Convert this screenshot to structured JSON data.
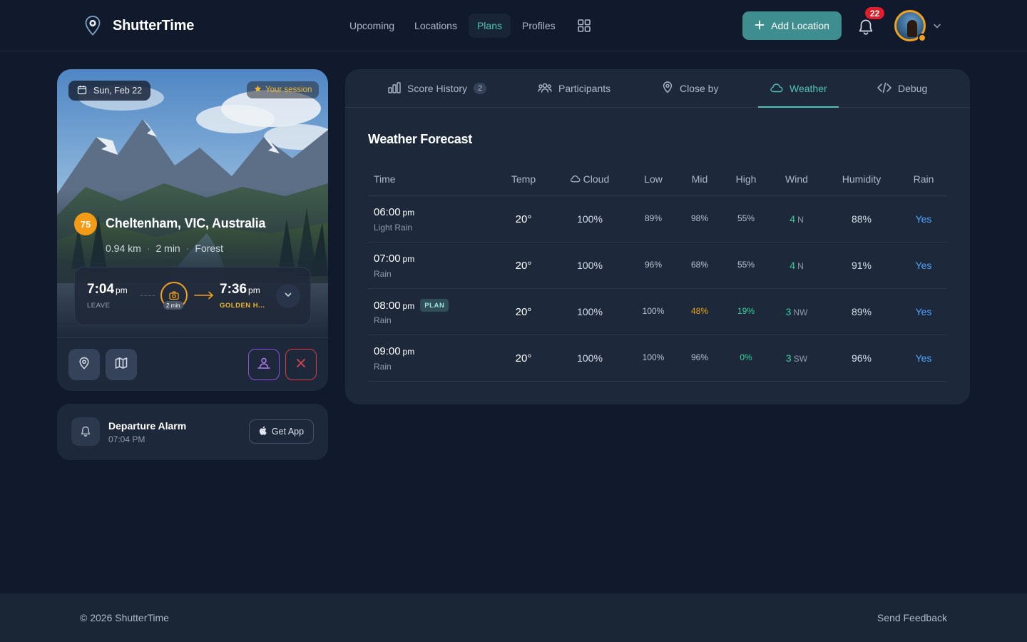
{
  "app": {
    "name": "ShutterTime"
  },
  "nav": {
    "items": [
      {
        "label": "Upcoming"
      },
      {
        "label": "Locations"
      },
      {
        "label": "Plans"
      },
      {
        "label": "Profiles"
      }
    ],
    "active": "Plans"
  },
  "header": {
    "add_location": "Add Location",
    "notifications": "22"
  },
  "location_card": {
    "date": "Sun, Feb 22",
    "session_label": "Your session",
    "score": "75",
    "title": "Cheltenham, VIC, Australia",
    "distance": "0.94 km",
    "duration": "2 min",
    "type": "Forest",
    "leave_time": "7:04",
    "leave_ampm": "pm",
    "leave_label": "LEAVE",
    "travel_label": "2 min",
    "golden_time": "7:36",
    "golden_ampm": "pm",
    "golden_label": "GOLDEN H..."
  },
  "alarm": {
    "title": "Departure Alarm",
    "time": "07:04 PM",
    "get_app": "Get App"
  },
  "tabs": [
    {
      "label": "Score History",
      "badge": "2"
    },
    {
      "label": "Participants"
    },
    {
      "label": "Close by"
    },
    {
      "label": "Weather"
    },
    {
      "label": "Debug"
    }
  ],
  "active_tab": "Weather",
  "weather": {
    "title": "Weather Forecast",
    "columns": [
      "Time",
      "Temp",
      "Cloud",
      "Low",
      "Mid",
      "High",
      "Wind",
      "Humidity",
      "Rain"
    ],
    "rows": [
      {
        "time": "06:00",
        "ampm": "pm",
        "desc": "Light Rain",
        "plan": "",
        "temp": "20°",
        "cloud": "100%",
        "low": "89%",
        "mid": "98%",
        "high": "55%",
        "wind_speed": "4",
        "wind_dir": "N",
        "humidity": "88%",
        "rain": "Yes"
      },
      {
        "time": "07:00",
        "ampm": "pm",
        "desc": "Rain",
        "plan": "",
        "temp": "20°",
        "cloud": "100%",
        "low": "96%",
        "mid": "68%",
        "high": "55%",
        "wind_speed": "4",
        "wind_dir": "N",
        "humidity": "91%",
        "rain": "Yes"
      },
      {
        "time": "08:00",
        "ampm": "pm",
        "desc": "Rain",
        "plan": "PLAN",
        "temp": "20°",
        "cloud": "100%",
        "low": "100%",
        "mid": "48%",
        "high": "19%",
        "wind_speed": "3",
        "wind_dir": "NW",
        "humidity": "89%",
        "rain": "Yes"
      },
      {
        "time": "09:00",
        "ampm": "pm",
        "desc": "Rain",
        "plan": "",
        "temp": "20°",
        "cloud": "100%",
        "low": "100%",
        "mid": "96%",
        "high": "0%",
        "wind_speed": "3",
        "wind_dir": "SW",
        "humidity": "96%",
        "rain": "Yes"
      }
    ]
  },
  "footer": {
    "copyright": "© 2026 ShutterTime",
    "feedback": "Send Feedback"
  },
  "colors": {
    "background": "#111a2c",
    "card": "#1d293b",
    "accent_teal": "#4ec3b8",
    "button_teal": "#3e8e8f",
    "gold": "#f2a21d",
    "wind_green": "#34d399",
    "rain_blue": "#4ea3ff",
    "mid_amber": "#e8a417",
    "badge_red": "#e01e2b"
  },
  "icons": [
    "location-pin-icon",
    "grid-icon",
    "plus-icon",
    "bell-icon",
    "chevron-down-icon",
    "calendar-icon",
    "star-icon",
    "camera-icon",
    "arrow-right-icon",
    "map-pin-icon",
    "map-icon",
    "person-icon",
    "close-icon",
    "apple-icon",
    "bar-chart-icon",
    "users-icon",
    "cloud-icon",
    "code-icon"
  ]
}
